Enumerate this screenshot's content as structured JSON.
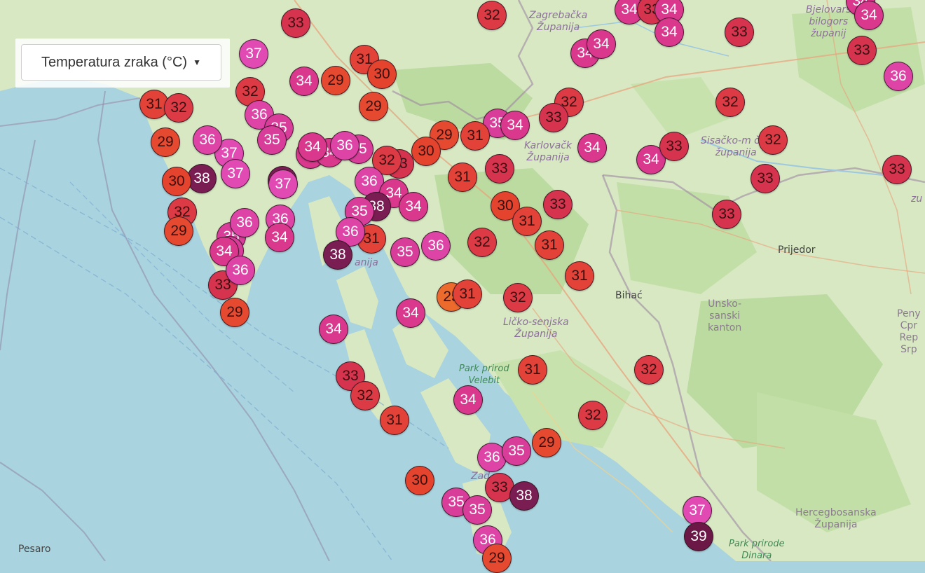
{
  "control": {
    "label": "Temperatura zraka (°C)",
    "caret": "caret-down-icon"
  },
  "colors": {
    "sea": "#a9d3de",
    "land": "#d7e8c3",
    "forest": "#bcdba0",
    "t25": "#ec6a2c",
    "t29": "#e54a30",
    "t30": "#e4432e",
    "t31": "#e24237",
    "t32": "#dc3b45",
    "t33": "#d6344e",
    "t34": "#d9388d",
    "t35": "#d93d9a",
    "t36": "#de44a6",
    "t37": "#e14ab3",
    "t38": "#7a1d52",
    "t39": "#6c1846"
  },
  "places": [
    {
      "text": "Zagrebačka\nŽupanija",
      "style": "italic"
    },
    {
      "text": "Bjelovars\nbilogors\nžupanij",
      "style": "italic"
    },
    {
      "text": "Karlovačk\nŽupanija",
      "style": "italic"
    },
    {
      "text": "Sisačko-m      čka\nžupanija",
      "style": "italic"
    },
    {
      "text": "Ličko-senjska\nŽupanija",
      "style": "italic"
    },
    {
      "text": "Park prirod\nVelebit",
      "style": "green"
    },
    {
      "text": "Park prirode\nDinara",
      "style": "green"
    },
    {
      "text": "Prijedor",
      "style": "city"
    },
    {
      "text": "Bihać",
      "style": "city"
    },
    {
      "text": "Unsko-\nsanski\nkanton",
      "style": ""
    },
    {
      "text": "Hercegbosanska\nŽupanija",
      "style": ""
    },
    {
      "text": "Peny\nCpr\nRep\nSrp",
      "style": ""
    },
    {
      "text": "Pesaro",
      "style": "city"
    },
    {
      "text": "Zad",
      "style": "italic"
    },
    {
      "text": "anija",
      "style": "italic"
    },
    {
      "text": "zu",
      "style": "italic"
    }
  ],
  "markers": [
    {
      "v": "33"
    },
    {
      "v": "32"
    },
    {
      "v": "34"
    },
    {
      "v": "33"
    },
    {
      "v": "34"
    },
    {
      "v": "34"
    },
    {
      "v": "34"
    },
    {
      "v": "33"
    },
    {
      "v": "37"
    },
    {
      "v": "34"
    },
    {
      "v": "34"
    },
    {
      "v": "31"
    },
    {
      "v": "30"
    },
    {
      "v": "33"
    },
    {
      "v": "34"
    },
    {
      "v": "36"
    },
    {
      "v": "34"
    },
    {
      "v": "29"
    },
    {
      "v": "32"
    },
    {
      "v": "29"
    },
    {
      "v": "32"
    },
    {
      "v": "31"
    },
    {
      "v": "32"
    },
    {
      "v": "36"
    },
    {
      "v": "32"
    },
    {
      "v": "35"
    },
    {
      "v": "34"
    },
    {
      "v": "35"
    },
    {
      "v": "33"
    },
    {
      "v": "29"
    },
    {
      "v": "34"
    },
    {
      "v": "34"
    },
    {
      "v": "35"
    },
    {
      "v": "31"
    },
    {
      "v": "29"
    },
    {
      "v": "32"
    },
    {
      "v": "34"
    },
    {
      "v": "34"
    },
    {
      "v": "33"
    },
    {
      "v": "37"
    },
    {
      "v": "36"
    },
    {
      "v": "35"
    },
    {
      "v": "36"
    },
    {
      "v": "34"
    },
    {
      "v": "30"
    },
    {
      "v": "33"
    },
    {
      "v": "32"
    },
    {
      "v": "31"
    },
    {
      "v": "38"
    },
    {
      "v": "38"
    },
    {
      "v": "30"
    },
    {
      "v": "37"
    },
    {
      "v": "36"
    },
    {
      "v": "33"
    },
    {
      "v": "34"
    },
    {
      "v": "33"
    },
    {
      "v": "33"
    },
    {
      "v": "37"
    },
    {
      "v": "32"
    },
    {
      "v": "34"
    },
    {
      "v": "30"
    },
    {
      "v": "31"
    },
    {
      "v": "33"
    },
    {
      "v": "33"
    },
    {
      "v": "38"
    },
    {
      "v": "35"
    },
    {
      "v": "29"
    },
    {
      "v": "35"
    },
    {
      "v": "36"
    },
    {
      "v": "36"
    },
    {
      "v": "31"
    },
    {
      "v": "35"
    },
    {
      "v": "36"
    },
    {
      "v": "31"
    },
    {
      "v": "32"
    },
    {
      "v": "34"
    },
    {
      "v": "35"
    },
    {
      "v": "36"
    },
    {
      "v": "38"
    },
    {
      "v": "34"
    },
    {
      "v": "33"
    },
    {
      "v": "25"
    },
    {
      "v": "31"
    },
    {
      "v": "32"
    },
    {
      "v": "31"
    },
    {
      "v": "36"
    },
    {
      "v": "29"
    },
    {
      "v": "34"
    },
    {
      "v": "34"
    },
    {
      "v": "31"
    },
    {
      "v": "32"
    },
    {
      "v": "33"
    },
    {
      "v": "32"
    },
    {
      "v": "34"
    },
    {
      "v": "31"
    },
    {
      "v": "32"
    },
    {
      "v": "29"
    },
    {
      "v": "36"
    },
    {
      "v": "35"
    },
    {
      "v": "30"
    },
    {
      "v": "35"
    },
    {
      "v": "33"
    },
    {
      "v": "38"
    },
    {
      "v": "35"
    },
    {
      "v": "36"
    },
    {
      "v": "37"
    },
    {
      "v": "39"
    },
    {
      "v": "29"
    }
  ]
}
